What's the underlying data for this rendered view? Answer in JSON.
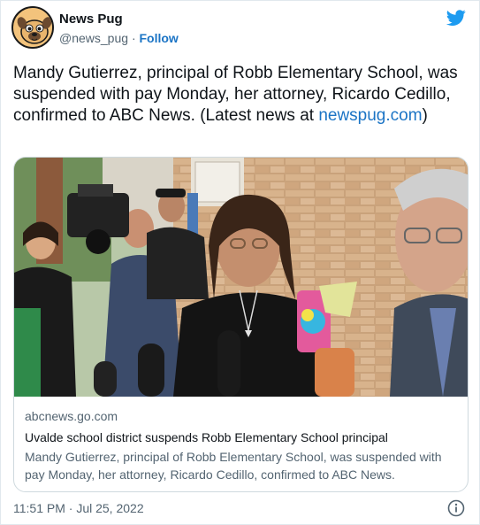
{
  "author": {
    "display_name": "News Pug",
    "handle": "@news_pug",
    "separator": "·",
    "follow_label": "Follow"
  },
  "tweet": {
    "text": "Mandy Gutierrez, principal of Robb Elementary School, was suspended with pay Monday, her attorney, Ricardo Cedillo, confirmed to ABC News. (Latest news at ",
    "link_text": "newspug.com",
    "text_end": ")"
  },
  "card": {
    "domain": "abcnews.go.com",
    "title": "Uvalde school district suspends Robb Elementary School principal",
    "description": "Mandy Gutierrez, principal of Robb Elementary School, was suspended with pay Monday, her attorney, Ricardo Cedillo, confirmed to ABC News."
  },
  "timestamp": "11:51 PM · Jul 25, 2022",
  "icons": {
    "brand": "twitter-bird-icon",
    "info": "info-icon"
  },
  "colors": {
    "link": "#1b74c5",
    "twitter_blue": "#1d9bf0",
    "secondary_text": "#536471",
    "border": "#cfd9de"
  }
}
